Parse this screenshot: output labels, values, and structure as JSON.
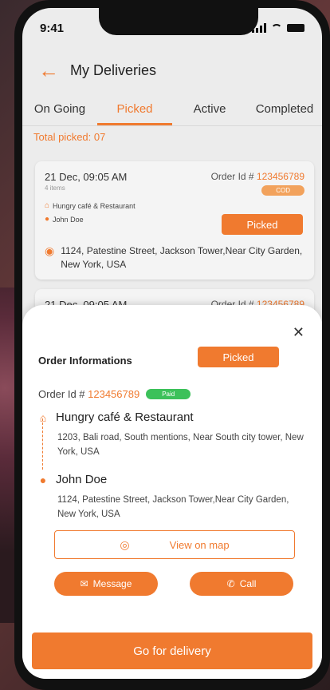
{
  "status": {
    "time": "9:41"
  },
  "header": {
    "title": "My Deliveries"
  },
  "tabs": [
    {
      "label": "On Going"
    },
    {
      "label": "Picked"
    },
    {
      "label": "Active"
    },
    {
      "label": "Completed"
    }
  ],
  "active_tab": "Picked",
  "total_picked": "Total picked: 07",
  "cards": [
    {
      "date": "21 Dec, 09:05 AM",
      "items": "4 items",
      "order_prefix": "Order Id # ",
      "order_num": "123456789",
      "payment": "COD",
      "restaurant": "Hungry café & Restaurant",
      "customer": "John Doe",
      "status_button": "Picked",
      "address": "1124, Patestine Street, Jackson Tower,Near City Garden, New York, USA"
    },
    {
      "date": "21 Dec, 09:05 AM",
      "order_prefix": "Order Id # ",
      "order_num": "123456789"
    }
  ],
  "sheet": {
    "title": "Order Informations",
    "status_button": "Picked",
    "order_prefix": "Order Id # ",
    "order_num": "123456789",
    "payment": "Paid",
    "restaurant_name": "Hungry café & Restaurant",
    "restaurant_address": "1203, Bali road, South mentions, Near South city tower, New York, USA",
    "customer_name": "John Doe",
    "customer_address": "1124, Patestine Street, Jackson Tower,Near City Garden, New York, USA",
    "view_map": "View on map",
    "message": "Message",
    "call": "Call",
    "go": "Go for delivery"
  },
  "colors": {
    "accent": "#f07a2f",
    "paid": "#3cc15a",
    "cod": "#f2a25c"
  },
  "icons": {
    "back": "back-arrow-icon",
    "close": "close-icon",
    "restaurant": "restaurant-icon",
    "person": "person-icon",
    "location": "location-pin-icon",
    "target": "target-icon",
    "mail": "mail-icon",
    "phone": "phone-icon"
  }
}
